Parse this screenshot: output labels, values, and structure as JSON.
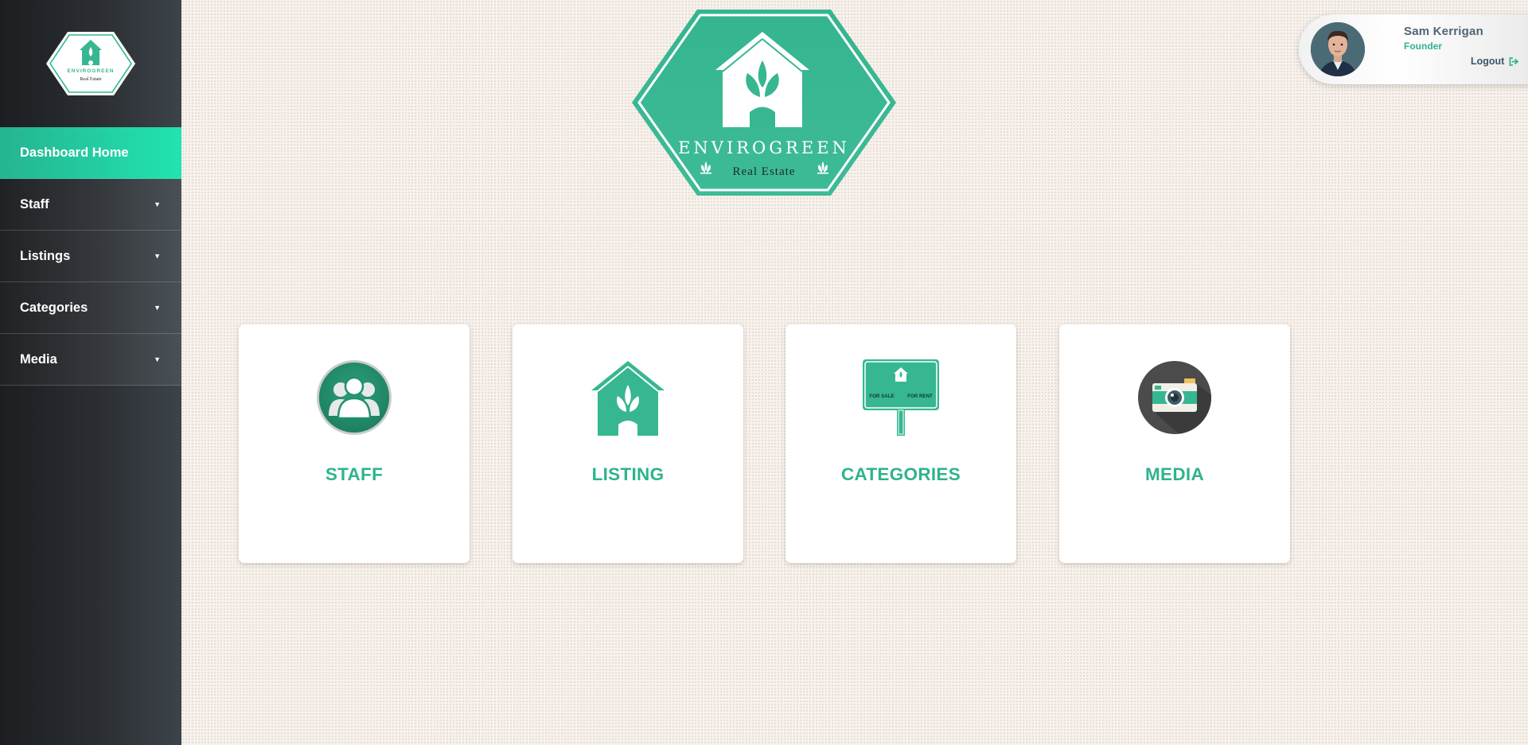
{
  "brand": {
    "name": "ENVIROGREEN",
    "tagline": "Real Estate",
    "color": "#36b791"
  },
  "sidebar": {
    "items": [
      {
        "label": "Dashboard Home",
        "active": true,
        "has_caret": false
      },
      {
        "label": "Staff",
        "active": false,
        "has_caret": true
      },
      {
        "label": "Listings",
        "active": false,
        "has_caret": true
      },
      {
        "label": "Categories",
        "active": false,
        "has_caret": true
      },
      {
        "label": "Media",
        "active": false,
        "has_caret": true
      }
    ],
    "caret": "▼"
  },
  "user": {
    "name": "Sam Kerrigan",
    "role": "Founder",
    "logout_label": "Logout"
  },
  "cards": [
    {
      "label": "STAFF",
      "icon": "staff-group-icon"
    },
    {
      "label": "LISTING",
      "icon": "house-leaf-icon"
    },
    {
      "label": "CATEGORIES",
      "icon": "sale-sign-icon"
    },
    {
      "label": "MEDIA",
      "icon": "camera-icon"
    }
  ],
  "sale_sign": {
    "left": "FOR SALE",
    "right": "FOR RENT"
  },
  "colors": {
    "accent": "#2eb38e",
    "accent_light": "#22e3b0",
    "sidebar_dark": "#1c1e21",
    "text_blue_gray": "#4f6573"
  }
}
